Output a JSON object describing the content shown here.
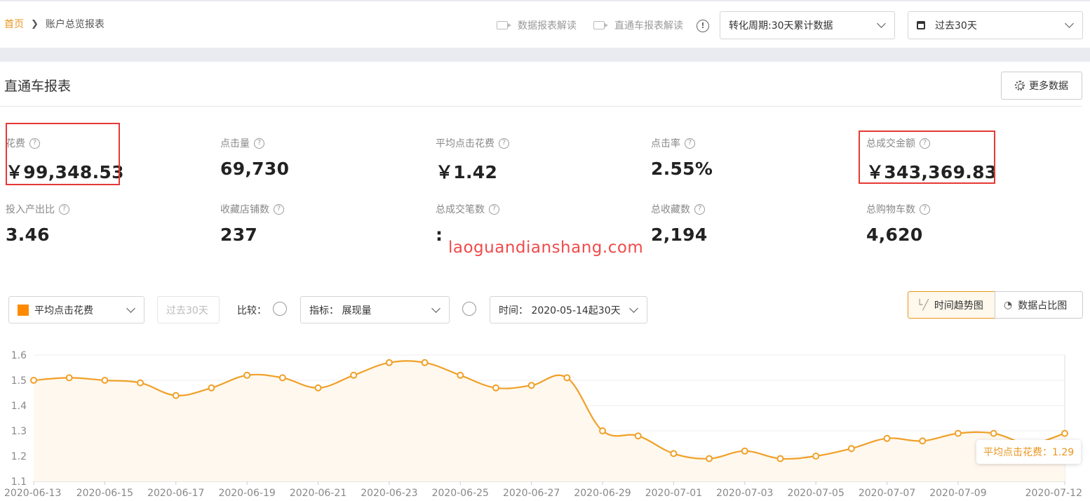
{
  "breadcrumb": {
    "home": "首页",
    "current": "账户总览报表"
  },
  "top_links": [
    {
      "label": "数据报表解读"
    },
    {
      "label": "直通车报表解读"
    }
  ],
  "period_select": {
    "value": "转化周期:30天累计数据"
  },
  "date_select": {
    "value": "过去30天"
  },
  "section": {
    "title": "直通车报表",
    "more_button": "更多数据"
  },
  "metrics": [
    {
      "label": "花费",
      "value": "￥99,348.53"
    },
    {
      "label": "点击量",
      "value": "69,730"
    },
    {
      "label": "平均点击花费",
      "value": "￥1.42"
    },
    {
      "label": "点击率",
      "value": "2.55%"
    },
    {
      "label": "总成交金额",
      "value": "￥343,369.83"
    },
    {
      "label": "投入产出比",
      "value": "3.46"
    },
    {
      "label": "收藏店铺数",
      "value": "237"
    },
    {
      "label": "总成交笔数",
      "value": ":"
    },
    {
      "label": "总收藏数",
      "value": "2,194"
    },
    {
      "label": "总购物车数",
      "value": "4,620"
    }
  ],
  "watermark": "laoguandianshang.com",
  "controls": {
    "metric_select": "平均点击花费",
    "range_button": "过去30天",
    "compare_label": "比较：",
    "indicator_select": "指标： 展现量",
    "time_select": "时间： 2020-05-14起30天",
    "trend_tab": "时间趋势图",
    "share_tab": "数据占比图"
  },
  "tooltip": "平均点击花费：1.29",
  "colors": {
    "accent": "#e8961f",
    "series": "#f0a028",
    "highlight": "#e53935"
  },
  "chart_data": {
    "type": "line",
    "x": [
      "2020-06-13",
      "2020-06-14",
      "2020-06-15",
      "2020-06-16",
      "2020-06-17",
      "2020-06-18",
      "2020-06-19",
      "2020-06-20",
      "2020-06-21",
      "2020-06-22",
      "2020-06-23",
      "2020-06-24",
      "2020-06-25",
      "2020-06-26",
      "2020-06-27",
      "2020-06-28",
      "2020-06-29",
      "2020-06-30",
      "2020-07-01",
      "2020-07-02",
      "2020-07-03",
      "2020-07-04",
      "2020-07-05",
      "2020-07-06",
      "2020-07-07",
      "2020-07-08",
      "2020-07-09",
      "2020-07-10",
      "2020-07-11",
      "2020-07-12"
    ],
    "xticks": [
      "2020-06-13",
      "2020-06-15",
      "2020-06-17",
      "2020-06-19",
      "2020-06-21",
      "2020-06-23",
      "2020-06-25",
      "2020-06-27",
      "2020-06-29",
      "2020-07-01",
      "2020-07-03",
      "2020-07-05",
      "2020-07-07",
      "2020-07-09",
      "2020-07-12"
    ],
    "series": [
      {
        "name": "平均点击花费",
        "values": [
          1.5,
          1.51,
          1.5,
          1.49,
          1.44,
          1.47,
          1.52,
          1.51,
          1.47,
          1.52,
          1.57,
          1.57,
          1.52,
          1.47,
          1.48,
          1.51,
          1.3,
          1.28,
          1.21,
          1.19,
          1.22,
          1.19,
          1.2,
          1.23,
          1.27,
          1.26,
          1.29,
          1.29,
          1.25,
          1.29
        ]
      }
    ],
    "yticks": [
      "1.1",
      "1.2",
      "1.3",
      "1.4",
      "1.5",
      "1.6"
    ],
    "ylim": [
      1.1,
      1.6
    ],
    "grid": true
  }
}
